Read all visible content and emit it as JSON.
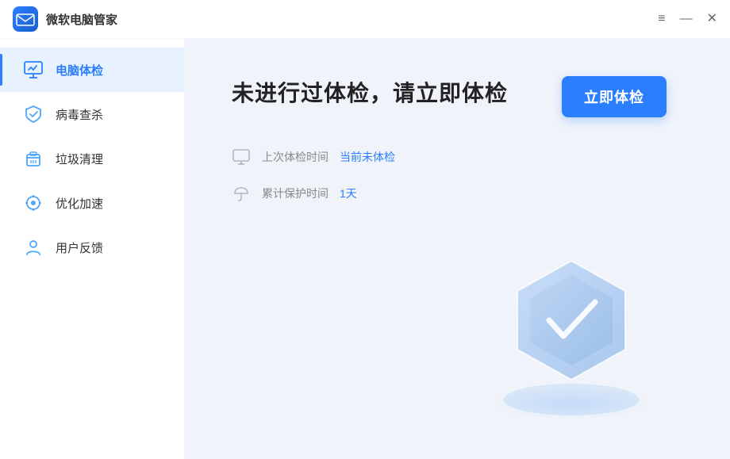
{
  "titlebar": {
    "logo_alt": "微软电脑管家 logo",
    "title": "微软电脑管家",
    "menu_icon": "≡",
    "minimize_icon": "—",
    "close_icon": "✕"
  },
  "sidebar": {
    "items": [
      {
        "id": "pc-checkup",
        "label": "电脑体检",
        "active": true
      },
      {
        "id": "antivirus",
        "label": "病毒查杀",
        "active": false
      },
      {
        "id": "cleanup",
        "label": "垃圾清理",
        "active": false
      },
      {
        "id": "optimize",
        "label": "优化加速",
        "active": false
      },
      {
        "id": "feedback",
        "label": "用户反馈",
        "active": false
      }
    ]
  },
  "content": {
    "main_title": "未进行过体检，请立即体检",
    "check_btn_label": "立即体检",
    "last_check_label": "上次体检时间",
    "last_check_value": "当前未体检",
    "protection_label": "累计保护时间",
    "protection_value": "1天"
  },
  "colors": {
    "accent": "#2b7fff",
    "sidebar_active_bg": "#e8f2ff",
    "sidebar_active_bar": "#2b7fff"
  }
}
